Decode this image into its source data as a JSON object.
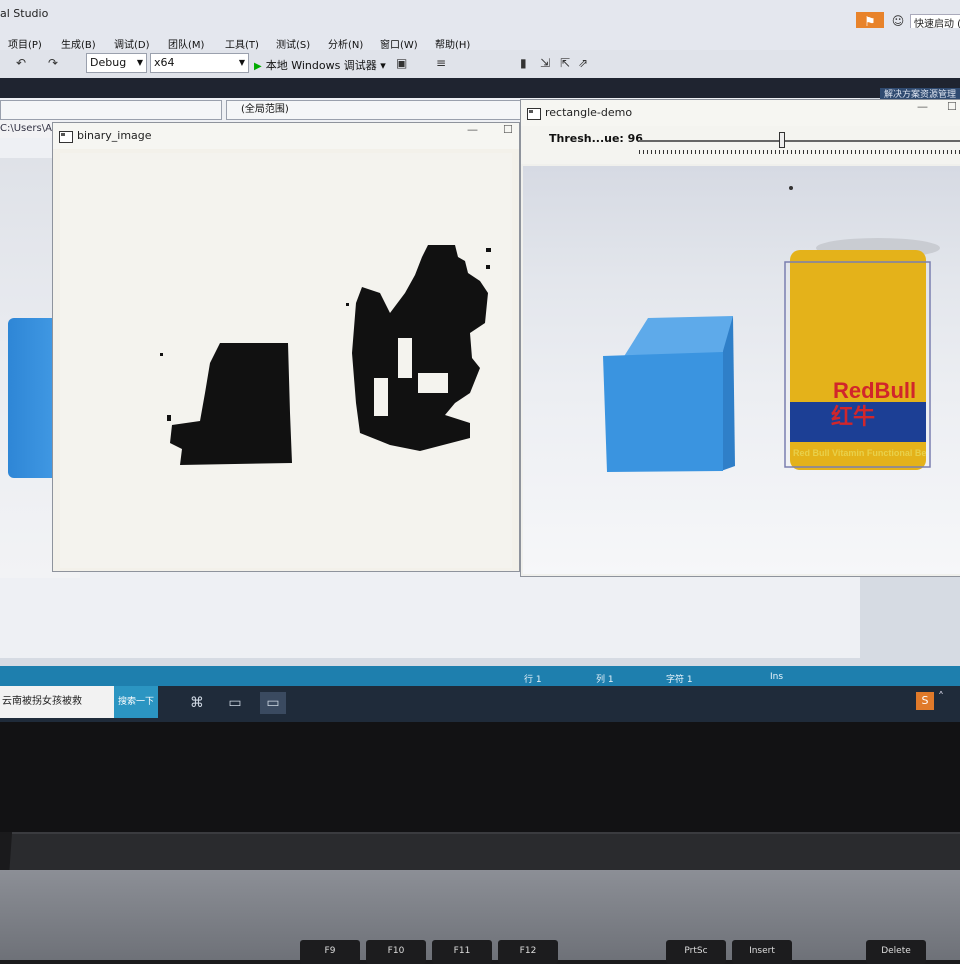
{
  "titlebar": {
    "title": "al Studio",
    "quick_launch": "快速启动 ("
  },
  "menu": [
    "项目(P)",
    "生成(B)",
    "调试(D)",
    "团队(M)",
    "工具(T)",
    "测试(S)",
    "分析(N)",
    "窗口(W)",
    "帮助(H)"
  ],
  "toolbar": {
    "config": "Debug",
    "platform": "x64",
    "run_label": "本地 Windows 调试器"
  },
  "editor": {
    "scope_combo": "(全局范围)",
    "path_tab": "C:\\Users\\A",
    "solution_explorer": "解决方案资源管理"
  },
  "binary_window": {
    "title": "binary_image"
  },
  "rect_window": {
    "title": "rectangle-demo",
    "trackbar_label": "Thresh...ue: 96",
    "threshold": 96,
    "can_text_brand": "RedBull",
    "can_text_cn": "红牛",
    "can_text_sub": "Red Bull Vitamin Functional Be"
  },
  "statusbar": {
    "row": "行 1",
    "col": "列 1",
    "char": "字符 1",
    "ins": "Ins"
  },
  "taskbar": {
    "search_text": "云南被拐女孩被救",
    "search_button": "搜索一下"
  },
  "keyboard": [
    "F9",
    "F10",
    "F11",
    "F12",
    "PrtSc",
    "Insert",
    "Delete"
  ],
  "colors": {
    "status_blue": "#1e7fae",
    "cube_blue": "#3a94e0",
    "can_gold": "#e4b21a",
    "brand_red": "#d1262b"
  }
}
